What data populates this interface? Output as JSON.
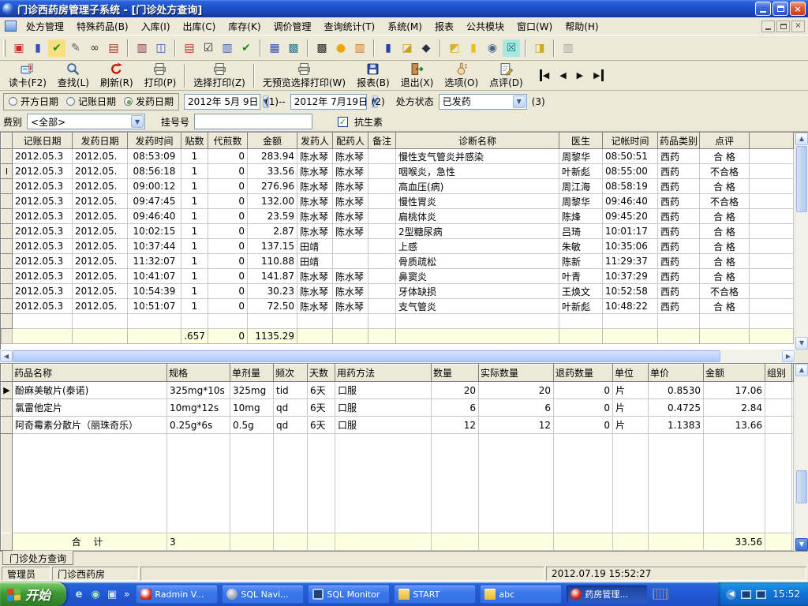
{
  "window": {
    "title": "门诊西药房管理子系统 - [门诊处方查询]"
  },
  "colors": {
    "title_gradient": "#1E50C8",
    "summary_row_bg": "#FFFFE1",
    "taskbar_blue": "#2157D2",
    "start_green": "#3E9A34",
    "grid_line": "#C8C8C8",
    "toolbar_bg": "#ECE9D8"
  },
  "menu": {
    "items": [
      "处方管理",
      "特殊药品(B)",
      "入库(I)",
      "出库(C)",
      "库存(K)",
      "调价管理",
      "查询统计(T)",
      "系统(M)",
      "报表",
      "公共模块",
      "窗口(W)",
      "帮助(H)"
    ]
  },
  "toolbar_main": {
    "icons": [
      {
        "name": "card-reader-icon",
        "glyph": "▣",
        "color": "#C03028"
      },
      {
        "name": "medicine-bottle-icon",
        "glyph": "▮",
        "color": "#3050C0"
      },
      {
        "name": "mail-check-icon",
        "glyph": "✔",
        "color": "#209020",
        "bg": "#F8E080"
      },
      {
        "name": "edit-note-icon",
        "glyph": "✎",
        "color": "#606060"
      },
      {
        "name": "binoculars-icon",
        "glyph": "∞",
        "color": "#303030"
      },
      {
        "name": "catalog-book-icon",
        "glyph": "▤",
        "color": "#A03028"
      },
      {
        "sep": true
      },
      {
        "name": "book-search-icon",
        "glyph": "▥",
        "color": "#883040"
      },
      {
        "name": "new-window-icon",
        "glyph": "◫",
        "color": "#3858B8"
      },
      {
        "sep": true
      },
      {
        "name": "clipboard-add-icon",
        "glyph": "▤",
        "color": "#B83030"
      },
      {
        "name": "verify-check-icon",
        "glyph": "☑",
        "color": "#202020"
      },
      {
        "name": "clipboard-import-icon",
        "glyph": "▥",
        "color": "#3858C0"
      },
      {
        "name": "clipboard-ok-icon",
        "glyph": "✔",
        "color": "#208820"
      },
      {
        "sep": true
      },
      {
        "name": "calendar-edit-icon",
        "glyph": "▦",
        "color": "#3050B0"
      },
      {
        "name": "calendar-report-icon",
        "glyph": "▩",
        "color": "#307888"
      },
      {
        "sep": true
      },
      {
        "name": "keypad-icon",
        "glyph": "▩",
        "color": "#282828"
      },
      {
        "name": "bell-icon",
        "glyph": "●",
        "color": "#E8A800"
      },
      {
        "name": "manual-book-icon",
        "glyph": "▥",
        "color": "#D87818"
      },
      {
        "sep": true
      },
      {
        "name": "trash-icon",
        "glyph": "▮",
        "color": "#2840A8"
      },
      {
        "name": "folder-search-icon",
        "glyph": "◪",
        "color": "#C8A020"
      },
      {
        "name": "find-record-icon",
        "glyph": "◆",
        "color": "#283048"
      },
      {
        "sep": true
      },
      {
        "name": "folder-open-icon",
        "glyph": "◩",
        "color": "#D8B030"
      },
      {
        "name": "thermometer-icon",
        "glyph": "▮",
        "color": "#E8C020"
      },
      {
        "name": "zoom-icon",
        "glyph": "◉",
        "color": "#486890"
      },
      {
        "name": "close-box-icon",
        "glyph": "☒",
        "color": "#107878",
        "bg": "#A8E8E0"
      },
      {
        "sep": true
      },
      {
        "name": "send-folder-icon",
        "glyph": "◨",
        "color": "#D0A828"
      },
      {
        "sep": true
      },
      {
        "name": "offline-book-icon",
        "glyph": "▥",
        "color": "#A8A49A"
      }
    ]
  },
  "toolbar_actions": {
    "buttons": [
      {
        "name": "read-card",
        "label": "读卡(F2)",
        "icon": "card"
      },
      {
        "name": "find",
        "label": "查找(L)",
        "icon": "magnifier"
      },
      {
        "name": "refresh",
        "label": "刷新(R)",
        "icon": "refresh"
      },
      {
        "name": "print",
        "label": "打印(P)",
        "icon": "printer"
      },
      {
        "sep": true
      },
      {
        "name": "select-print",
        "label": "选择打印(Z)",
        "icon": "printer"
      },
      {
        "sep": true
      },
      {
        "name": "no-preview-select-print",
        "label": "无预览选择打印(W)",
        "icon": "printer"
      },
      {
        "name": "report",
        "label": "报表(B)",
        "icon": "floppy"
      },
      {
        "name": "exit",
        "label": "退出(X)",
        "icon": "door"
      },
      {
        "name": "options",
        "label": "选项(O)",
        "icon": "hand"
      },
      {
        "name": "review",
        "label": "点评(D)",
        "icon": "note"
      }
    ],
    "nav": [
      {
        "name": "first-record",
        "glyph": "◀",
        "bar": "L"
      },
      {
        "name": "prev-record",
        "glyph": "◀"
      },
      {
        "name": "next-record",
        "glyph": "▶"
      },
      {
        "name": "last-record",
        "glyph": "▶",
        "bar": "R"
      }
    ]
  },
  "filters": {
    "date_type": {
      "options": [
        {
          "name": "prescribe-date",
          "label": "开方日期",
          "selected": false
        },
        {
          "name": "booking-date",
          "label": "记账日期",
          "selected": false
        },
        {
          "name": "dispense-date",
          "label": "发药日期",
          "selected": true
        }
      ]
    },
    "date_from": "2012年 5月 9日",
    "sep1": "(1)--",
    "date_to": "2012年 7月19日",
    "sep2": "(2)",
    "status_label": "处方状态",
    "status_value": "已发药",
    "sep3": "(3)",
    "fee_label": "费别",
    "fee_value": "<全部>",
    "regno_label": "挂号号",
    "regno_value": "",
    "antibiotic_label": "抗生素",
    "antibiotic_checked": true
  },
  "main_grid": {
    "columns": [
      "记账日期",
      "发药日期",
      "发药时间",
      "贴数",
      "代煎数",
      "金额",
      "发药人",
      "配药人",
      "备注",
      "诊断名称",
      "医生",
      "记帐时间",
      "药品类别",
      "点评"
    ],
    "rows": [
      {
        "ind": "",
        "cells": [
          "2012.05.3",
          "2012.05.",
          "08:53:09",
          "1",
          "0",
          "283.94",
          "陈水琴",
          "陈水琴",
          "",
          "慢性支气管炎并感染",
          "周黎华",
          "08:50:51",
          "西药",
          "合  格"
        ]
      },
      {
        "ind": "I",
        "cells": [
          "2012.05.3",
          "2012.05.",
          "08:56:18",
          "1",
          "0",
          "33.56",
          "陈水琴",
          "陈水琴",
          "",
          "咽喉炎，急性",
          "叶新彪",
          "08:55:00",
          "西药",
          "不合格"
        ]
      },
      {
        "ind": "",
        "cells": [
          "2012.05.3",
          "2012.05.",
          "09:00:12",
          "1",
          "0",
          "276.96",
          "陈水琴",
          "陈水琴",
          "",
          "高血压(病)",
          "周江海",
          "08:58:19",
          "西药",
          "合  格"
        ]
      },
      {
        "ind": "",
        "cells": [
          "2012.05.3",
          "2012.05.",
          "09:47:45",
          "1",
          "0",
          "132.00",
          "陈水琴",
          "陈水琴",
          "",
          "慢性胃炎",
          "周黎华",
          "09:46:40",
          "西药",
          "不合格"
        ]
      },
      {
        "ind": "",
        "cells": [
          "2012.05.3",
          "2012.05.",
          "09:46:40",
          "1",
          "0",
          "23.59",
          "陈水琴",
          "陈水琴",
          "",
          "扁桃体炎",
          "陈烽",
          "09:45:20",
          "西药",
          "合  格"
        ]
      },
      {
        "ind": "",
        "cells": [
          "2012.05.3",
          "2012.05.",
          "10:02:15",
          "1",
          "0",
          "2.87",
          "陈水琴",
          "陈水琴",
          "",
          "2型糖尿病",
          "吕琦",
          "10:01:17",
          "西药",
          "合  格"
        ]
      },
      {
        "ind": "",
        "cells": [
          "2012.05.3",
          "2012.05.",
          "10:37:44",
          "1",
          "0",
          "137.15",
          "田靖",
          "",
          "",
          "上感",
          "朱敏",
          "10:35:06",
          "西药",
          "合  格"
        ]
      },
      {
        "ind": "",
        "cells": [
          "2012.05.3",
          "2012.05.",
          "11:32:07",
          "1",
          "0",
          "110.88",
          "田靖",
          "",
          "",
          "骨质疏松",
          "陈新",
          "11:29:37",
          "西药",
          "合  格"
        ]
      },
      {
        "ind": "",
        "cells": [
          "2012.05.3",
          "2012.05.",
          "10:41:07",
          "1",
          "0",
          "141.87",
          "陈水琴",
          "陈水琴",
          "",
          "鼻窦炎",
          "叶青",
          "10:37:29",
          "西药",
          "合  格"
        ]
      },
      {
        "ind": "",
        "cells": [
          "2012.05.3",
          "2012.05.",
          "10:54:39",
          "1",
          "0",
          "30.23",
          "陈水琴",
          "陈水琴",
          "",
          "牙体缺损",
          "王焕文",
          "10:52:58",
          "西药",
          "不合格"
        ]
      },
      {
        "ind": "",
        "cells": [
          "2012.05.3",
          "2012.05.",
          "10:51:07",
          "1",
          "0",
          "72.50",
          "陈水琴",
          "陈水琴",
          "",
          "支气管炎",
          "叶新彪",
          "10:48:22",
          "西药",
          "合  格"
        ]
      }
    ],
    "summary": [
      "",
      "",
      "",
      ".657",
      "0",
      "1135.29",
      "",
      "",
      "",
      "",
      "",
      "",
      "",
      ""
    ]
  },
  "detail_grid": {
    "columns": [
      "药品名称",
      "规格",
      "单剂量",
      "频次",
      "天数",
      "用药方法",
      "数量",
      "实际数量",
      "退药数量",
      "单位",
      "单价",
      "金额",
      "组别"
    ],
    "rows": [
      {
        "ind": "▶",
        "cells": [
          "酚麻美敏片(泰诺)",
          "325mg*10s",
          "325mg",
          "tid",
          "6天",
          "口服",
          "20",
          "20",
          "0",
          "片",
          "0.8530",
          "17.06",
          ""
        ]
      },
      {
        "ind": "",
        "cells": [
          "氯雷他定片",
          "10mg*12s",
          "10mg",
          "qd",
          "6天",
          "口服",
          "6",
          "6",
          "0",
          "片",
          "0.4725",
          "2.84",
          ""
        ]
      },
      {
        "ind": "",
        "cells": [
          "阿奇霉素分散片（丽珠奇乐）",
          "0.25g*6s",
          "0.5g",
          "qd",
          "6天",
          "口服",
          "12",
          "12",
          "0",
          "片",
          "1.1383",
          "13.66",
          ""
        ]
      }
    ],
    "summary": [
      "合  计",
      "3",
      "",
      "",
      "",
      "",
      "",
      "",
      "",
      "",
      "",
      "33.56",
      ""
    ]
  },
  "doc_tab": "门诊处方查询",
  "statusbar": {
    "user": "管理员",
    "dept": "门诊西药房",
    "datetime": "2012.07.19 15:52:27"
  },
  "taskbar": {
    "start": "开始",
    "quicklaunch": [
      {
        "name": "ie-icon",
        "glyph": "e",
        "color": "#BCE4FF"
      },
      {
        "name": "media-player-icon",
        "glyph": "◉",
        "color": "#A8E8A0"
      },
      {
        "name": "messenger-icon",
        "glyph": "▣",
        "color": "#D8E0F0"
      }
    ],
    "overflow_glyph": "»",
    "tasks": [
      {
        "name": "task-radmin",
        "label": "Radmin V...",
        "icon": "radmin",
        "active": false
      },
      {
        "name": "task-sql-navigator",
        "label": "SQL Navi...",
        "icon": "compass",
        "active": false
      },
      {
        "name": "task-sql-monitor",
        "label": "SQL Monitor",
        "icon": "monitor",
        "active": false
      },
      {
        "name": "task-start-folder",
        "label": "START",
        "icon": "folder",
        "active": false
      },
      {
        "name": "task-abc-folder",
        "label": "abc",
        "icon": "folder",
        "active": false
      },
      {
        "name": "task-pharmacy",
        "label": "药房管理...",
        "icon": "pharm",
        "active": true
      }
    ],
    "clock": "15:52"
  }
}
